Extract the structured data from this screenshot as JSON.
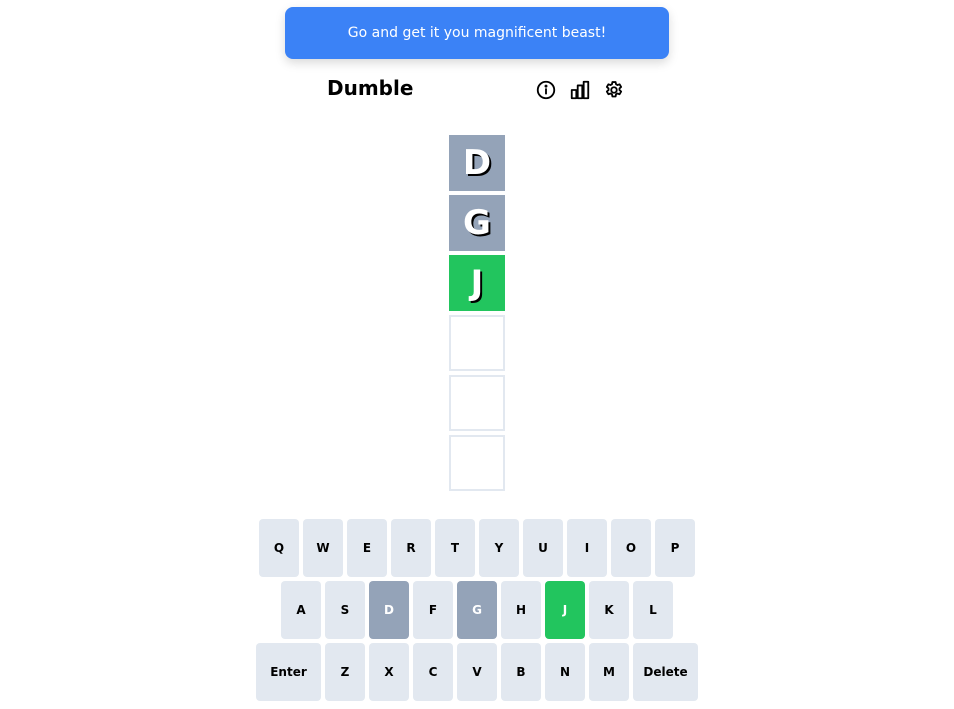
{
  "toast": {
    "message": "Go and get it you magnificent beast!"
  },
  "header": {
    "title": "Dumble",
    "icons": [
      "info-icon",
      "stats-icon",
      "settings-icon"
    ]
  },
  "grid": {
    "rows": [
      {
        "letter": "D",
        "state": "absent"
      },
      {
        "letter": "G",
        "state": "absent"
      },
      {
        "letter": "J",
        "state": "correct"
      },
      {
        "letter": "",
        "state": "empty"
      },
      {
        "letter": "",
        "state": "empty"
      },
      {
        "letter": "",
        "state": "empty"
      }
    ]
  },
  "keyboard": {
    "row1": [
      {
        "label": "Q",
        "state": ""
      },
      {
        "label": "W",
        "state": ""
      },
      {
        "label": "E",
        "state": ""
      },
      {
        "label": "R",
        "state": ""
      },
      {
        "label": "T",
        "state": ""
      },
      {
        "label": "Y",
        "state": ""
      },
      {
        "label": "U",
        "state": ""
      },
      {
        "label": "I",
        "state": ""
      },
      {
        "label": "O",
        "state": ""
      },
      {
        "label": "P",
        "state": ""
      }
    ],
    "row2": [
      {
        "label": "A",
        "state": ""
      },
      {
        "label": "S",
        "state": ""
      },
      {
        "label": "D",
        "state": "absent"
      },
      {
        "label": "F",
        "state": ""
      },
      {
        "label": "G",
        "state": "absent"
      },
      {
        "label": "H",
        "state": ""
      },
      {
        "label": "J",
        "state": "correct"
      },
      {
        "label": "K",
        "state": ""
      },
      {
        "label": "L",
        "state": ""
      }
    ],
    "row3": [
      {
        "label": "Enter",
        "state": "",
        "wide": true
      },
      {
        "label": "Z",
        "state": ""
      },
      {
        "label": "X",
        "state": ""
      },
      {
        "label": "C",
        "state": ""
      },
      {
        "label": "V",
        "state": ""
      },
      {
        "label": "B",
        "state": ""
      },
      {
        "label": "N",
        "state": ""
      },
      {
        "label": "M",
        "state": ""
      },
      {
        "label": "Delete",
        "state": "",
        "wide": true
      }
    ]
  },
  "colors": {
    "toast": "#3b82f6",
    "absent": "#94a3b8",
    "correct": "#22c55e",
    "key": "#e2e8f0"
  }
}
